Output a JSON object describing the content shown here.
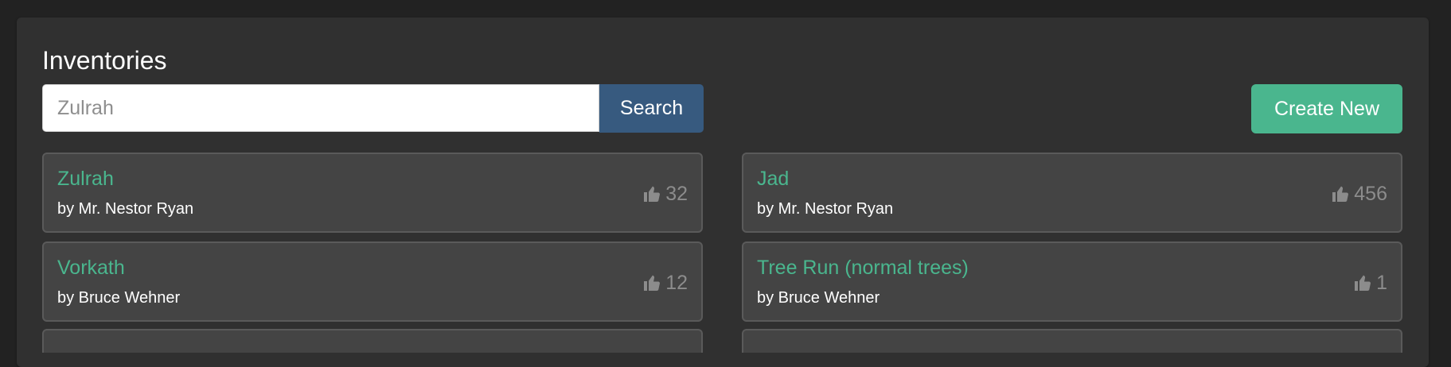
{
  "page": {
    "title": "Inventories"
  },
  "search": {
    "value": "",
    "placeholder": "Zulrah",
    "button_label": "Search"
  },
  "actions": {
    "create_label": "Create New"
  },
  "inventories": [
    {
      "name": "Zulrah",
      "author": "by Mr. Nestor Ryan",
      "likes": "32"
    },
    {
      "name": "Jad",
      "author": "by Mr. Nestor Ryan",
      "likes": "456"
    },
    {
      "name": "Vorkath",
      "author": "by Bruce Wehner",
      "likes": "12"
    },
    {
      "name": "Tree Run (normal trees)",
      "author": "by Bruce Wehner",
      "likes": "1"
    }
  ],
  "icons": {
    "like": "thumbs-up-icon"
  },
  "colors": {
    "background": "#222222",
    "panel": "#303030",
    "card": "#444444",
    "accent_green": "#4ab68e",
    "search_blue": "#375a7f",
    "muted_text": "#8c8c8c"
  }
}
